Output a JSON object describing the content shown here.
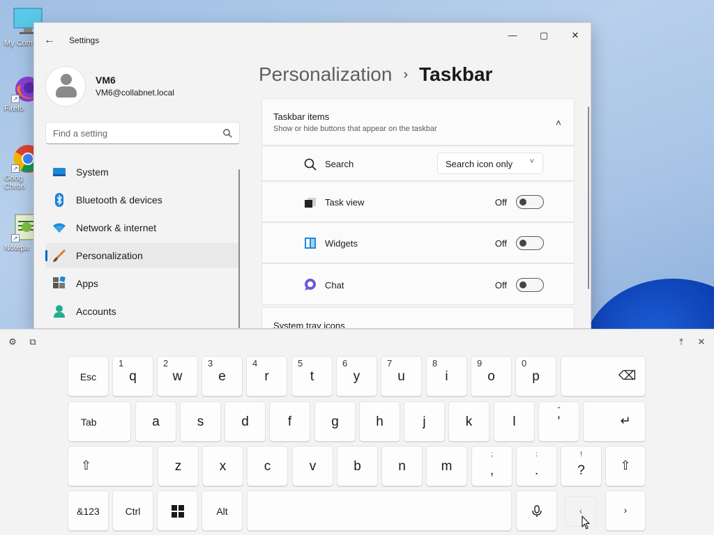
{
  "desktop": {
    "icons": [
      {
        "label": "My Com",
        "icon": "computer-icon"
      },
      {
        "label": "Firefo",
        "icon": "firefox-icon"
      },
      {
        "label": "Goog",
        "label2": "Chron",
        "icon": "chrome-icon"
      },
      {
        "label": "Notepa",
        "icon": "notepad-icon"
      }
    ]
  },
  "window": {
    "title": "Settings",
    "back_icon": "←",
    "minimize": "—",
    "maximize": "▢",
    "close": "✕"
  },
  "profile": {
    "name": "VM6",
    "email": "VM6@collabnet.local"
  },
  "search": {
    "placeholder": "Find a setting"
  },
  "nav": {
    "items": [
      {
        "label": "System",
        "icon": "system-icon"
      },
      {
        "label": "Bluetooth & devices",
        "icon": "bluetooth-icon"
      },
      {
        "label": "Network & internet",
        "icon": "network-icon"
      },
      {
        "label": "Personalization",
        "icon": "personalization-icon",
        "active": true
      },
      {
        "label": "Apps",
        "icon": "apps-icon"
      },
      {
        "label": "Accounts",
        "icon": "accounts-icon"
      }
    ]
  },
  "breadcrumb": {
    "parent": "Personalization",
    "separator": "›",
    "current": "Taskbar"
  },
  "taskbar_items": {
    "title": "Taskbar items",
    "subtitle": "Show or hide buttons that appear on the taskbar",
    "chevron": "˄",
    "search": {
      "label": "Search",
      "value": "Search icon only",
      "chevron": "˅"
    },
    "task_view": {
      "label": "Task view",
      "state": "Off"
    },
    "widgets": {
      "label": "Widgets",
      "state": "Off"
    },
    "chat": {
      "label": "Chat",
      "state": "Off"
    }
  },
  "system_tray": {
    "title": "System tray icons"
  },
  "keyboard": {
    "tools": {
      "settings": "⚙",
      "dock": "⧉",
      "undock": "⤒",
      "close": "✕"
    },
    "row1": [
      {
        "main": "Esc"
      },
      {
        "main": "q",
        "alt": "1"
      },
      {
        "main": "w",
        "alt": "2"
      },
      {
        "main": "e",
        "alt": "3"
      },
      {
        "main": "r",
        "alt": "4"
      },
      {
        "main": "t",
        "alt": "5"
      },
      {
        "main": "y",
        "alt": "6"
      },
      {
        "main": "u",
        "alt": "7"
      },
      {
        "main": "i",
        "alt": "8"
      },
      {
        "main": "o",
        "alt": "9"
      },
      {
        "main": "p",
        "alt": "0"
      },
      {
        "main": "⌫"
      }
    ],
    "row2": [
      {
        "main": "Tab"
      },
      {
        "main": "a"
      },
      {
        "main": "s"
      },
      {
        "main": "d"
      },
      {
        "main": "f"
      },
      {
        "main": "g"
      },
      {
        "main": "h"
      },
      {
        "main": "j"
      },
      {
        "main": "k"
      },
      {
        "main": "l"
      },
      {
        "main": "'",
        "alt": "\""
      },
      {
        "main": "↵"
      }
    ],
    "row3": [
      {
        "main": "⇧"
      },
      {
        "main": "z"
      },
      {
        "main": "x"
      },
      {
        "main": "c"
      },
      {
        "main": "v"
      },
      {
        "main": "b"
      },
      {
        "main": "n"
      },
      {
        "main": "m"
      },
      {
        "main": ",",
        "alt": ";"
      },
      {
        "main": ".",
        "alt": ":"
      },
      {
        "main": "?",
        "alt": "!"
      },
      {
        "main": "⇧"
      }
    ],
    "row4": [
      {
        "main": "&123"
      },
      {
        "main": "Ctrl"
      },
      {
        "main": "⊞"
      },
      {
        "main": "Alt"
      },
      {
        "main": ""
      },
      {
        "main": "🎙"
      },
      {
        "main": "‹"
      },
      {
        "main": "›"
      }
    ]
  }
}
